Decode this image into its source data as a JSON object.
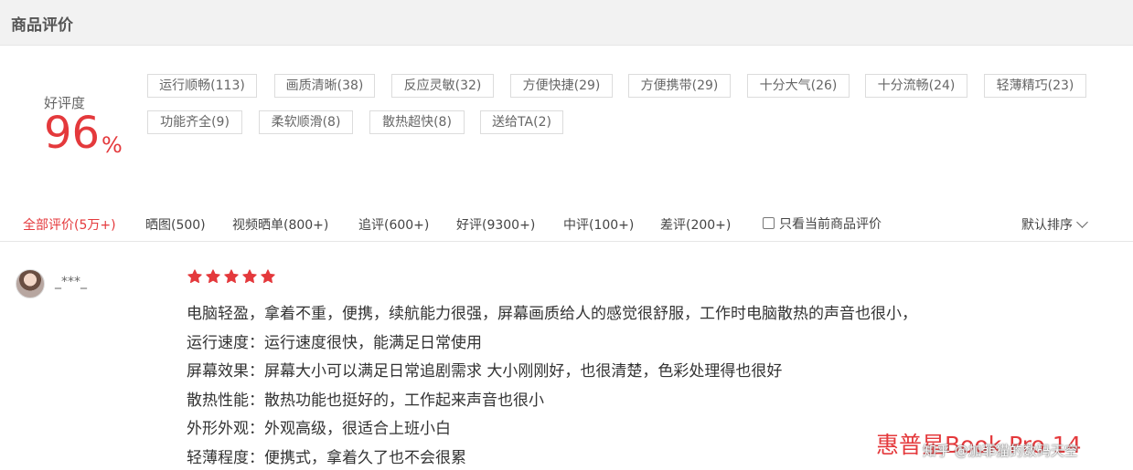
{
  "header": {
    "title": "商品评价"
  },
  "rating": {
    "label": "好评度",
    "value": "96",
    "unit": "%"
  },
  "tags": [
    "运行顺畅(113)",
    "画质清晰(38)",
    "反应灵敏(32)",
    "方便快捷(29)",
    "方便携带(29)",
    "十分大气(26)",
    "十分流畅(24)",
    "轻薄精巧(23)",
    "功能齐全(9)",
    "柔软顺滑(8)",
    "散热超快(8)",
    "送给TA(2)"
  ],
  "filters": {
    "items": [
      "全部评价(5万+)",
      "晒图(500)",
      "视频晒单(800+)",
      "追评(600+)",
      "好评(9300+)",
      "中评(100+)",
      "差评(200+)"
    ],
    "only_current": "只看当前商品评价",
    "sort": "默认排序"
  },
  "review": {
    "username": "_***_",
    "stars": 5,
    "lines": [
      "电脑轻盈，拿着不重，便携，续航能力很强，屏幕画质给人的感觉很舒服，工作时电脑散热的声音也很小，",
      "运行速度：运行速度很快，能满足日常使用",
      "屏幕效果：屏幕大小可以满足日常追剧需求 大小刚刚好，也很清楚，色彩处理得也很好",
      "散热性能：散热功能也挺好的，工作起来声音也很小",
      "外形外观：外观高级，很适合上班小白",
      "轻薄程度：便携式，拿着久了也不会很累"
    ]
  },
  "watermark": {
    "brand": "惠普星Book Pro 14",
    "source": "知乎 @加菲猫的数码天空"
  },
  "colors": {
    "accent": "#e4393c",
    "header_bg": "#f2f2f2"
  }
}
